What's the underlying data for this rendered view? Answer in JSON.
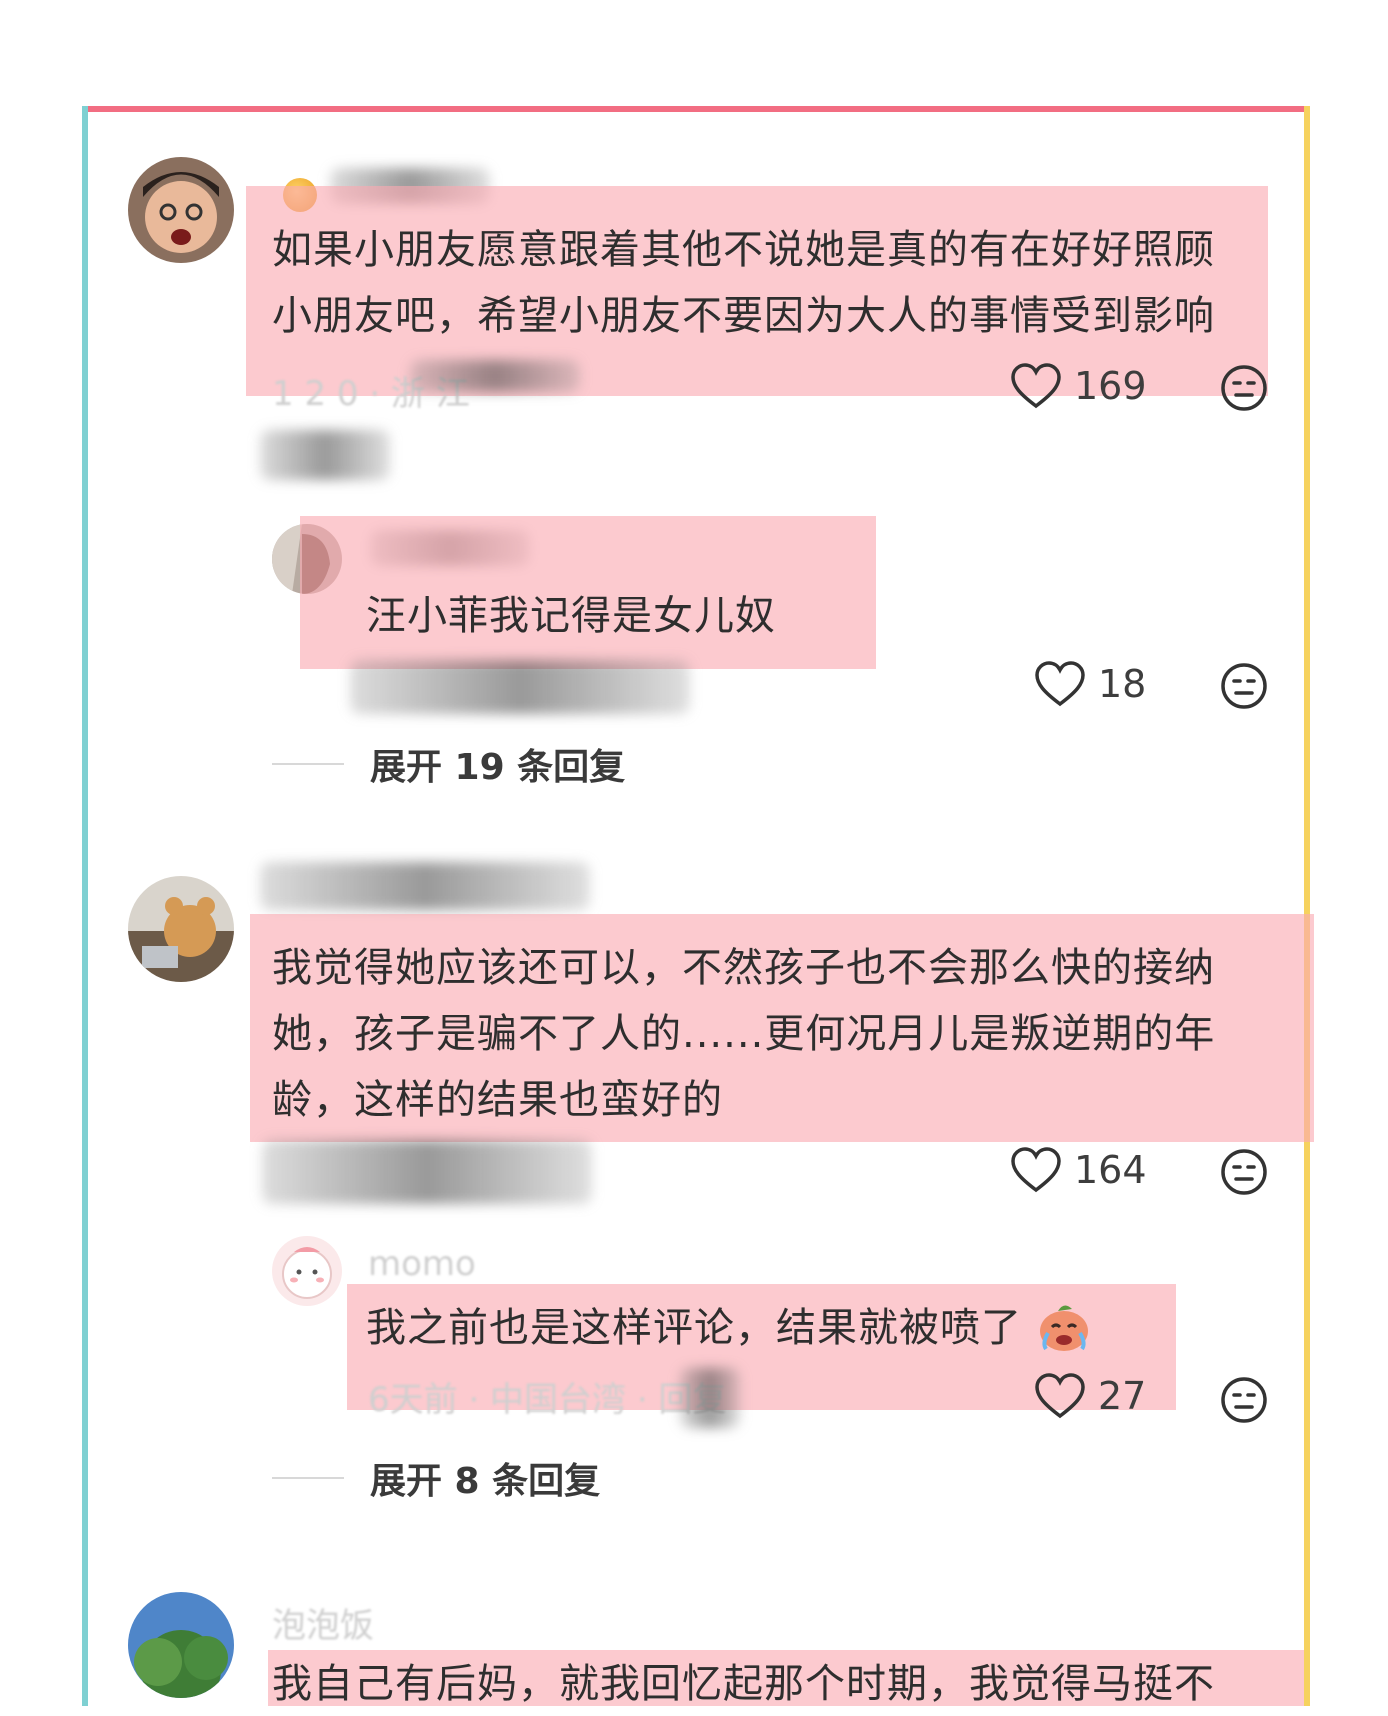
{
  "comments": [
    {
      "text_line1": "如果小朋友愿意跟着其他不说她是真的有在好好照顾",
      "text_line2": "小朋友吧，希望小朋友不要因为大人的事情受到影响",
      "likes": "169",
      "reply": {
        "text": "汪小菲我记得是女儿奴",
        "likes": "18"
      },
      "expand_label": "展开 19 条回复"
    },
    {
      "text_line1": "我觉得她应该还可以，不然孩子也不会那么快的接纳",
      "text_line2": "她，孩子是骗不了人的......更何况月儿是叛逆期的年",
      "text_line3": "龄，这样的结果也蛮好的",
      "likes": "164",
      "reply": {
        "username": "momo",
        "text": "我之前也是这样评论，结果就被喷了",
        "meta": "6天前 · 中国台湾 · 回复",
        "likes": "27"
      },
      "expand_label": "展开 8 条回复"
    },
    {
      "username": "泡泡饭",
      "text_line1": "我自己有后妈，就我回忆起那个时期，我觉得马挺不"
    }
  ],
  "colors": {
    "highlight": "#faaab2",
    "frame_top": "#f26d82",
    "frame_left": "#7fd0d2",
    "frame_right": "#f6d25e"
  },
  "icons": [
    "heart-outline-icon",
    "neutral-face-icon",
    "crying-emoji-icon"
  ]
}
